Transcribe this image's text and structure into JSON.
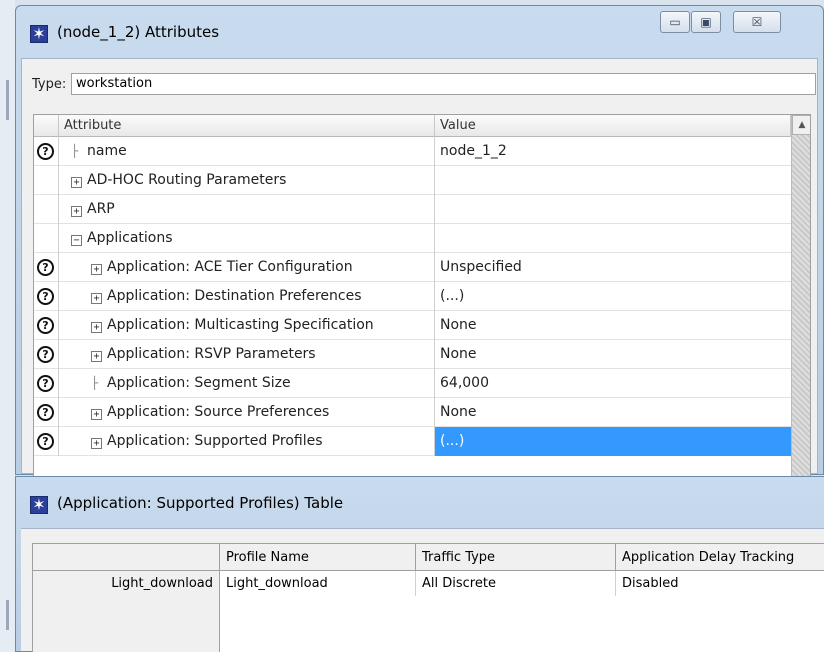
{
  "attributes_window": {
    "title": "(node_1_2) Attributes",
    "controls": {
      "minimize": "▭",
      "maximize": "▣",
      "close": "☒"
    },
    "type_label": "Type:",
    "type_value": "workstation",
    "columns": {
      "attribute": "Attribute",
      "value": "Value"
    },
    "rows": [
      {
        "help": true,
        "indent": 0,
        "glyph": "line",
        "label": "name",
        "value": "node_1_2"
      },
      {
        "help": false,
        "indent": 0,
        "glyph": "plus",
        "label": "AD-HOC Routing Parameters",
        "value": ""
      },
      {
        "help": false,
        "indent": 0,
        "glyph": "plus",
        "label": "ARP",
        "value": ""
      },
      {
        "help": false,
        "indent": 0,
        "glyph": "minus",
        "label": "Applications",
        "value": ""
      },
      {
        "help": true,
        "indent": 1,
        "glyph": "plus",
        "label": "Application: ACE Tier Configuration",
        "value": "Unspecified"
      },
      {
        "help": true,
        "indent": 1,
        "glyph": "plus",
        "label": "Application: Destination Preferences",
        "value": "(...)"
      },
      {
        "help": true,
        "indent": 1,
        "glyph": "plus",
        "label": "Application: Multicasting Specification",
        "value": "None"
      },
      {
        "help": true,
        "indent": 1,
        "glyph": "plus",
        "label": "Application: RSVP Parameters",
        "value": "None"
      },
      {
        "help": true,
        "indent": 1,
        "glyph": "line",
        "label": "Application: Segment Size",
        "value": "64,000"
      },
      {
        "help": true,
        "indent": 1,
        "glyph": "plus",
        "label": "Application: Source Preferences",
        "value": "None"
      },
      {
        "help": true,
        "indent": 1,
        "glyph": "plus",
        "label": "Application: Supported Profiles",
        "value": "(...)",
        "selected": true
      }
    ]
  },
  "table_window": {
    "title": "(Application: Supported Profiles) Table",
    "columns": [
      "",
      "Profile Name",
      "Traffic Type",
      "Application Delay Tracking"
    ],
    "rows": [
      {
        "header": "Light_download",
        "profile_name": "Light_download",
        "traffic_type": "All Discrete",
        "delay_tracking": "Disabled"
      }
    ]
  },
  "colors": {
    "selection": "#3399ff",
    "titlebar": "#c9dbee"
  }
}
